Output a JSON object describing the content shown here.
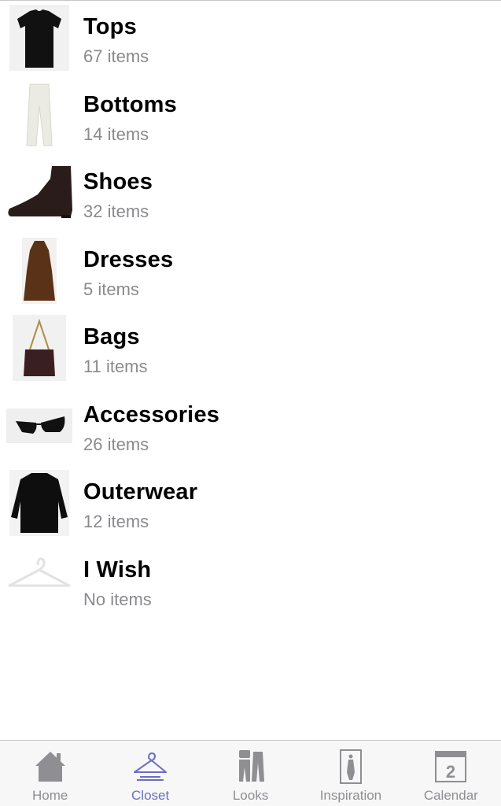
{
  "categories": [
    {
      "title": "Tops",
      "count": "67 items",
      "icon": "tshirt-icon"
    },
    {
      "title": "Bottoms",
      "count": "14 items",
      "icon": "pants-icon"
    },
    {
      "title": "Shoes",
      "count": "32 items",
      "icon": "boot-icon"
    },
    {
      "title": "Dresses",
      "count": "5 items",
      "icon": "dress-icon"
    },
    {
      "title": "Bags",
      "count": "11 items",
      "icon": "bag-icon"
    },
    {
      "title": "Accessories",
      "count": "26 items",
      "icon": "sunglasses-icon"
    },
    {
      "title": "Outerwear",
      "count": "12 items",
      "icon": "coat-icon"
    },
    {
      "title": "I Wish",
      "count": "No items",
      "icon": "hanger-icon"
    }
  ],
  "tabbar": {
    "tabs": [
      {
        "label": "Home",
        "icon": "home-icon",
        "active": false
      },
      {
        "label": "Closet",
        "icon": "hanger-icon",
        "active": true
      },
      {
        "label": "Looks",
        "icon": "looks-icon",
        "active": false
      },
      {
        "label": "Inspiration",
        "icon": "inspiration-icon",
        "active": false
      },
      {
        "label": "Calendar",
        "icon": "calendar-icon",
        "active": false,
        "badge": "2"
      }
    ]
  },
  "colors": {
    "accent": "#6b6fc2",
    "inactive": "#8e8e93",
    "subtitle": "#8a8a8e"
  }
}
